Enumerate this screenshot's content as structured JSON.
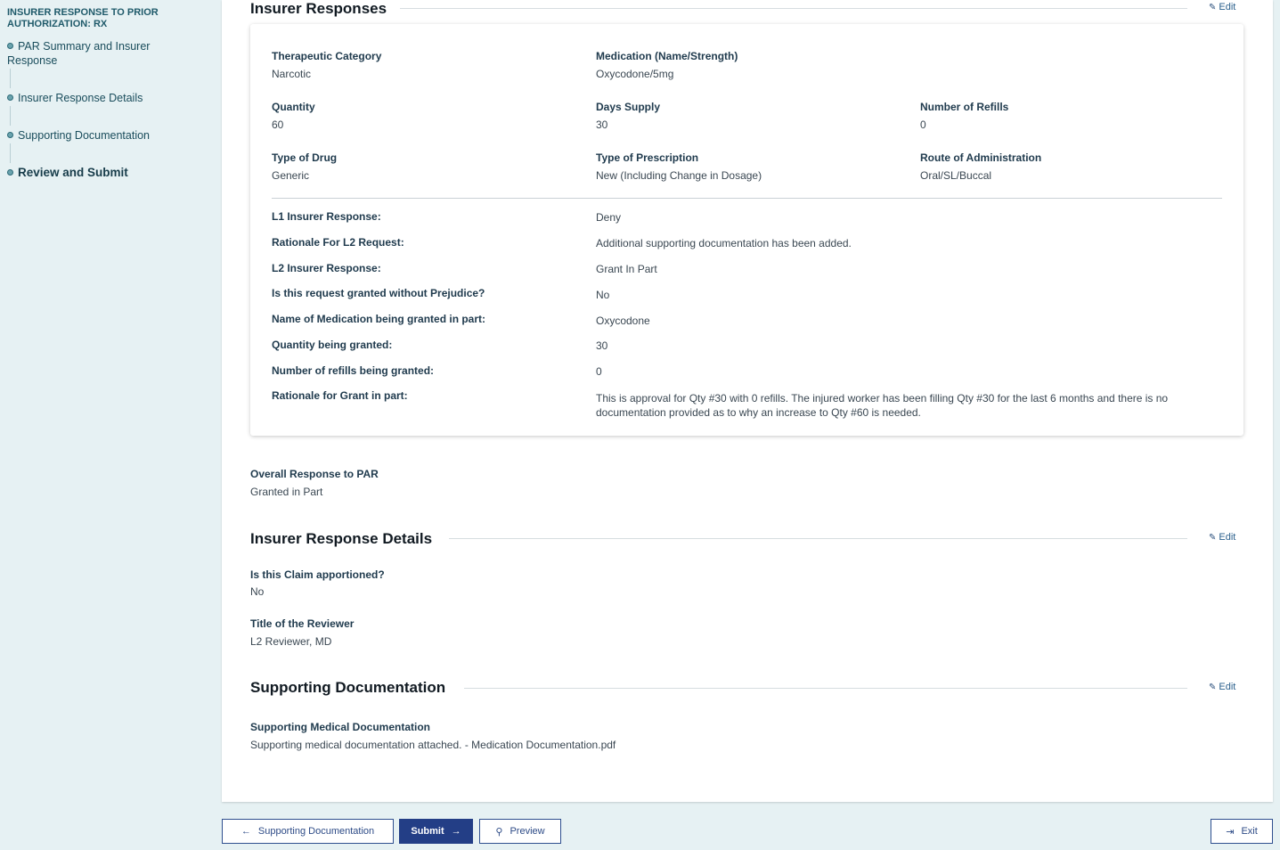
{
  "sidebar": {
    "title": "INSURER RESPONSE TO PRIOR AUTHORIZATION: RX",
    "items": [
      {
        "label": "PAR Summary and Insurer Response"
      },
      {
        "label": "Insurer Response Details"
      },
      {
        "label": "Supporting Documentation"
      },
      {
        "label": "Review and Submit"
      }
    ]
  },
  "sections": {
    "insurer_responses": {
      "heading": "Insurer Responses",
      "edit": "Edit"
    },
    "insurer_response_details": {
      "heading": "Insurer Response Details",
      "edit": "Edit"
    },
    "supporting_documentation": {
      "heading": "Supporting Documentation",
      "edit": "Edit"
    }
  },
  "medication": {
    "therapeutic_category": {
      "label": "Therapeutic Category",
      "value": "Narcotic"
    },
    "medication_name": {
      "label": "Medication (Name/Strength)",
      "value": "Oxycodone/5mg"
    },
    "quantity": {
      "label": "Quantity",
      "value": "60"
    },
    "days_supply": {
      "label": "Days Supply",
      "value": "30"
    },
    "refills": {
      "label": "Number of Refills",
      "value": "0"
    },
    "type_of_drug": {
      "label": "Type of Drug",
      "value": "Generic"
    },
    "type_of_prescription": {
      "label": "Type of Prescription",
      "value": "New (Including Change in Dosage)"
    },
    "route": {
      "label": "Route of Administration",
      "value": "Oral/SL/Buccal"
    }
  },
  "responses": [
    {
      "label": "L1 Insurer Response:",
      "value": "Deny"
    },
    {
      "label": "Rationale For L2 Request:",
      "value": "Additional supporting documentation has been added."
    },
    {
      "label": "L2 Insurer Response:",
      "value": "Grant In Part"
    },
    {
      "label": "Is this request granted without Prejudice?",
      "value": "No"
    },
    {
      "label": "Name of Medication being granted in part:",
      "value": "Oxycodone"
    },
    {
      "label": "Quantity being granted:",
      "value": "30"
    },
    {
      "label": "Number of refills being granted:",
      "value": "0"
    },
    {
      "label": "Rationale for Grant in part:",
      "value": "This is approval for Qty #30 with 0 refills. The injured worker has been filling Qty #30 for the last 6 months and there is no documentation provided as to why an increase to Qty #60 is needed."
    }
  ],
  "overall": {
    "label": "Overall Response to PAR",
    "value": "Granted in Part"
  },
  "details": {
    "apportioned": {
      "label": "Is this Claim apportioned?",
      "value": "No"
    },
    "reviewer": {
      "label": "Title of the Reviewer",
      "value": "L2 Reviewer, MD"
    }
  },
  "documentation": {
    "label": "Supporting Medical Documentation",
    "value": "Supporting medical documentation attached.  - Medication Documentation.pdf"
  },
  "footer": {
    "back_label": "Supporting Documentation",
    "submit_label": "Submit",
    "preview_label": "Preview",
    "exit_label": "Exit"
  }
}
